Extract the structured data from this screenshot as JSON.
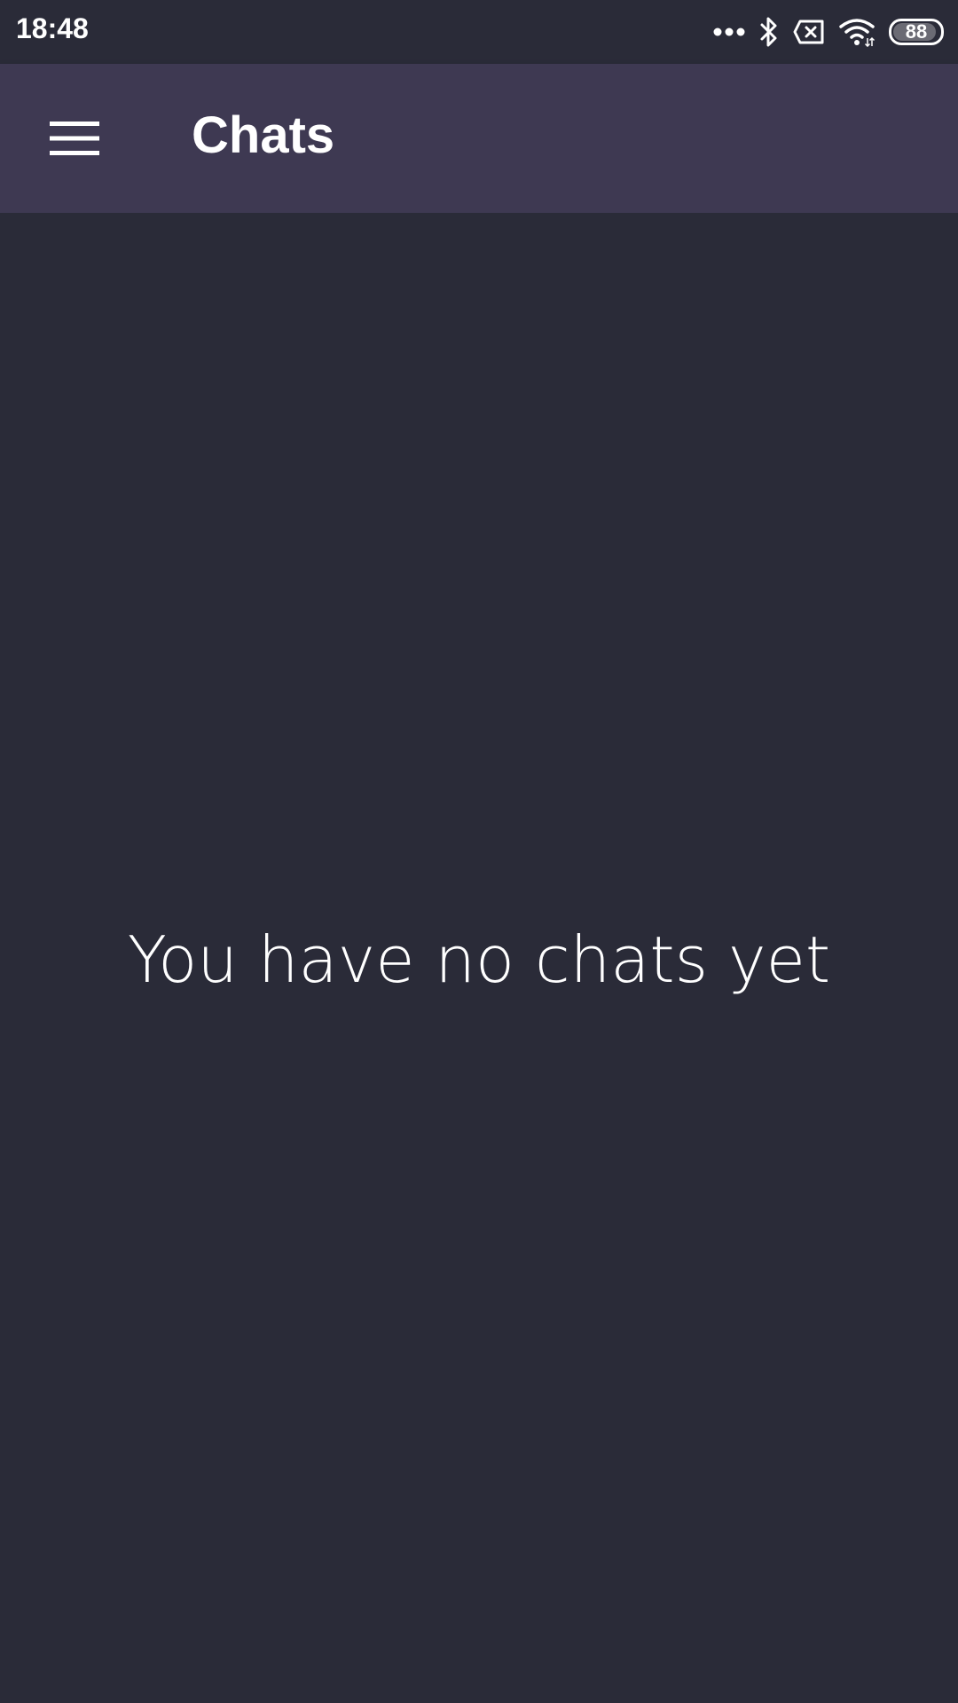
{
  "status_bar": {
    "time": "18:48",
    "battery_level": "88",
    "icons": [
      "more-dots-icon",
      "bluetooth-icon",
      "sim-off-icon",
      "wifi-icon",
      "battery-icon"
    ],
    "text_color": "#ffffff"
  },
  "app_bar": {
    "title": "Chats",
    "menu_icon": "hamburger-menu-icon",
    "background": "#3e3952"
  },
  "main": {
    "empty_message": "You have no chats yet",
    "background": "#2a2b38"
  }
}
